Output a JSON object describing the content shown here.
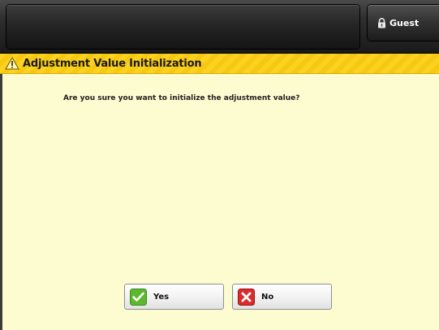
{
  "header": {
    "user_label": "Guest",
    "user_icon": "lock-icon"
  },
  "dialog": {
    "title": "Adjustment Value Initialization",
    "title_icon": "warning-icon",
    "message": "Are you sure you want to initialize the adjustment value?",
    "yes_label": "Yes",
    "yes_icon": "checkmark-icon",
    "no_label": "No",
    "no_icon": "x-icon"
  },
  "colors": {
    "background": "#fdfbd0",
    "title_bar": "#fbd220",
    "yes_icon": "#5cb82e",
    "no_icon": "#d92c2c"
  }
}
